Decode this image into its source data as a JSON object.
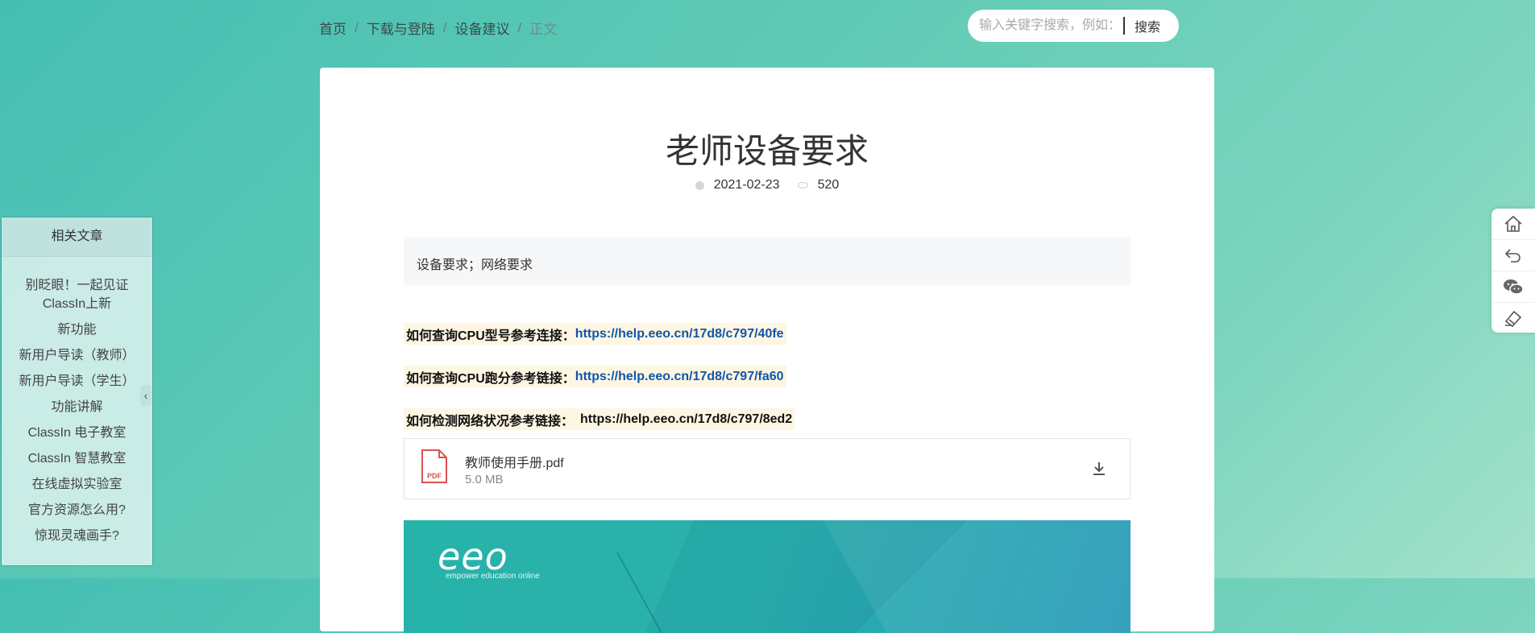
{
  "breadcrumb": {
    "home": "首页",
    "level1": "下载与登陆",
    "level2": "设备建议",
    "current": "正文",
    "separator": "/"
  },
  "search": {
    "placeholder": "输入关键字搜索，例如：",
    "button": "搜索"
  },
  "article": {
    "title": "老师设备要求",
    "date": "2021-02-23",
    "views": "520",
    "summary": "设备要求；网络要求",
    "refs": [
      {
        "label": "如何查询CPU型号参考连接：",
        "link": "https://help.eeo.cn/17d8/c797/40fe"
      },
      {
        "label": "如何查询CPU跑分参考链接：",
        "link": "https://help.eeo.cn/17d8/c797/fa60"
      },
      {
        "label": "如何检测网络状况参考链接：",
        "link": "https://help.eeo.cn/17d8/c797/8ed2"
      }
    ],
    "attachment": {
      "name": "教师使用手册.pdf",
      "size": "5.0 MB",
      "badge": "PDF"
    },
    "banner": {
      "logo": "eeo",
      "tagline": "empower education online"
    }
  },
  "sidebar": {
    "title": "相关文章",
    "items": [
      "别眨眼！一起见证",
      "ClassIn上新",
      "新功能",
      "新用户导读（教师）",
      "新用户导读（学生）",
      "功能讲解",
      "ClassIn 电子教室",
      "ClassIn 智慧教室",
      "在线虚拟实验室",
      "官方资源怎么用?",
      "惊现灵魂画手?"
    ],
    "collapse": "‹"
  },
  "right_tools": [
    "home-icon",
    "back-icon",
    "wechat-icon",
    "feedback-icon"
  ]
}
